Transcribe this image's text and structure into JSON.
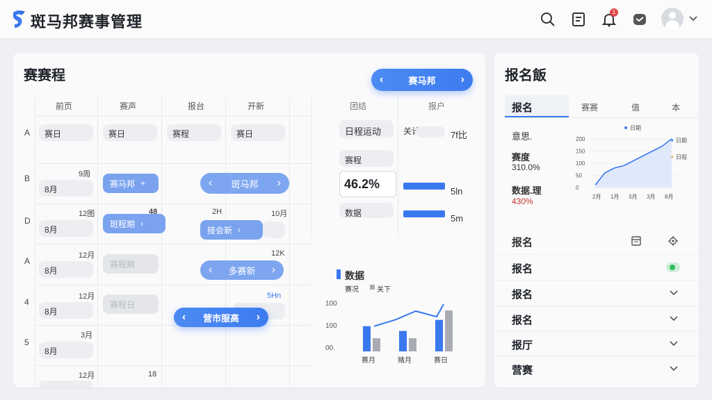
{
  "header": {
    "app_title": "斑马邦赛事管理",
    "notification_count": "1",
    "icons": [
      "logo-icon",
      "search-icon",
      "document-icon",
      "bell-icon",
      "message-icon",
      "avatar",
      "chevron-down-icon"
    ]
  },
  "schedule": {
    "title": "赛赛程",
    "team_switcher": "赛马邦",
    "columns": [
      "前页",
      "赛声",
      "报台",
      "开新"
    ],
    "rows": [
      {
        "label": "A",
        "cells": [
          "赛日",
          "赛日",
          "赛程",
          "赛日"
        ],
        "nums": []
      },
      {
        "label": "B",
        "cells": [
          "8月"
        ],
        "nums": [
          "9周"
        ]
      },
      {
        "label": "D",
        "cells": [
          "8月"
        ],
        "nums": [
          "12图",
          "48",
          "2H",
          "10月"
        ]
      },
      {
        "label": "A",
        "cells": [
          "8月"
        ],
        "nums": [
          "12月",
          "12K"
        ]
      },
      {
        "label": "4",
        "cells": [
          "8月"
        ],
        "nums": [
          "12月",
          "5Hn"
        ]
      },
      {
        "label": "5",
        "cells": [
          "8月"
        ],
        "nums": [
          "3月"
        ]
      },
      {
        "label": "",
        "cells": [],
        "nums": [
          "12月",
          "18"
        ]
      }
    ],
    "chips": {
      "b1": "赛马邦",
      "b2": "斑马邦",
      "d1": "斑程期",
      "d2": "接会新",
      "a1": "赛程期",
      "a2": "多赛新",
      "r4": "赛程日",
      "r4b": "营市服高"
    }
  },
  "stats": {
    "col_heads": [
      "团结",
      "报户"
    ],
    "activity_label": "日程运动",
    "activity_value": "关计",
    "activity_num": "7f比",
    "box2": "赛程",
    "big_value": "46.2%",
    "box3": "数据",
    "bar1_value": "5ln",
    "bar2_value": "5m"
  },
  "data_chart": {
    "title": "数据",
    "legend": [
      "赛况",
      "关下"
    ],
    "y_ticks": [
      "100",
      "100",
      "00."
    ],
    "x_labels": [
      "赛月",
      "赌月",
      "赛日"
    ],
    "colors": {
      "primary": "#3a78ee",
      "secondary": "#a9acb2"
    }
  },
  "chart_data": {
    "type": "bar",
    "categories": [
      "赛月",
      "赌月",
      "赛日"
    ],
    "series": [
      {
        "name": "赛况",
        "values": [
          80,
          65,
          100
        ]
      },
      {
        "name": "关下",
        "values": [
          42,
          42,
          130
        ]
      }
    ],
    "line": [
      80,
      100,
      128,
      110,
      150
    ],
    "ylim": [
      0,
      150
    ]
  },
  "signup": {
    "title": "报名飯",
    "tabs": [
      "报名",
      "赛赛",
      "值",
      "本"
    ],
    "info": [
      {
        "label": "意思."
      },
      {
        "label": "赛度",
        "value": "310.0%"
      },
      {
        "label": "数据.理",
        "value": "430%"
      }
    ],
    "mini_chart": {
      "legend": [
        "日期",
        "日期",
        "日程"
      ],
      "y_ticks": [
        "200",
        "150",
        "100",
        "50",
        "0"
      ],
      "x_labels": [
        "2月",
        "1月",
        "3月",
        "3月",
        "8月"
      ],
      "values": [
        10,
        60,
        80,
        90,
        110,
        130,
        150,
        170,
        200
      ]
    },
    "list_header": "报名",
    "list_items": [
      {
        "label": "报名",
        "status": "toggle-on"
      },
      {
        "label": "报名",
        "status": "check"
      },
      {
        "label": "报名",
        "status": "check"
      },
      {
        "label": "报厅",
        "status": "check"
      },
      {
        "label": "营赛",
        "status": "check"
      }
    ]
  }
}
